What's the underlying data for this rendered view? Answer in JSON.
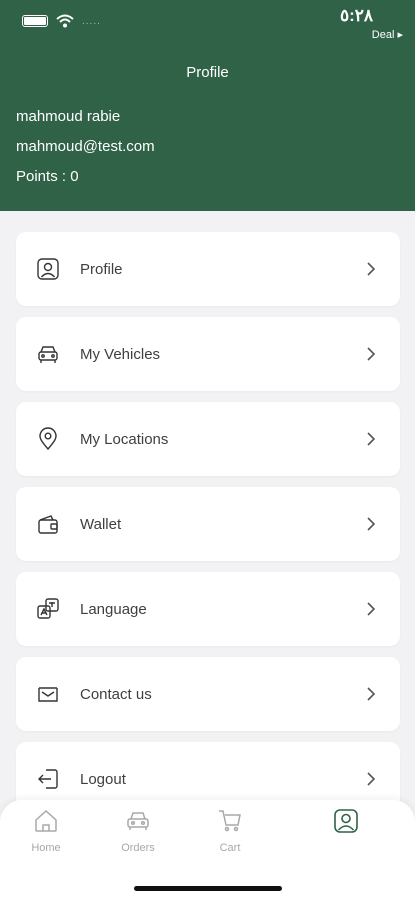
{
  "status_bar": {
    "time": "٥:٢٨",
    "back_app": "Deal ▸",
    "carrier": "....."
  },
  "header": {
    "title": "Profile"
  },
  "user": {
    "name": "mahmoud rabie",
    "email": "mahmoud@test.com",
    "points": "Points : 0"
  },
  "menu": [
    {
      "label": "Profile",
      "icon": "user-square-icon"
    },
    {
      "label": "My Vehicles",
      "icon": "car-icon"
    },
    {
      "label": "My Locations",
      "icon": "location-pin-icon"
    },
    {
      "label": "Wallet",
      "icon": "wallet-icon"
    },
    {
      "label": "Language",
      "icon": "language-icon"
    },
    {
      "label": "Contact us",
      "icon": "contact-mail-icon"
    },
    {
      "label": "Logout",
      "icon": "logout-icon"
    }
  ],
  "tabs": [
    {
      "label": "Home",
      "icon": "home-icon"
    },
    {
      "label": "Orders",
      "icon": "car-icon"
    },
    {
      "label": "Cart",
      "icon": "cart-icon"
    },
    {
      "label": "",
      "icon": "profile-icon"
    }
  ],
  "colors": {
    "primary": "#2f6246",
    "background": "#f2f2f4",
    "card": "#ffffff",
    "text": "#3f3f3f",
    "tab_inactive": "#a8a8a8"
  }
}
